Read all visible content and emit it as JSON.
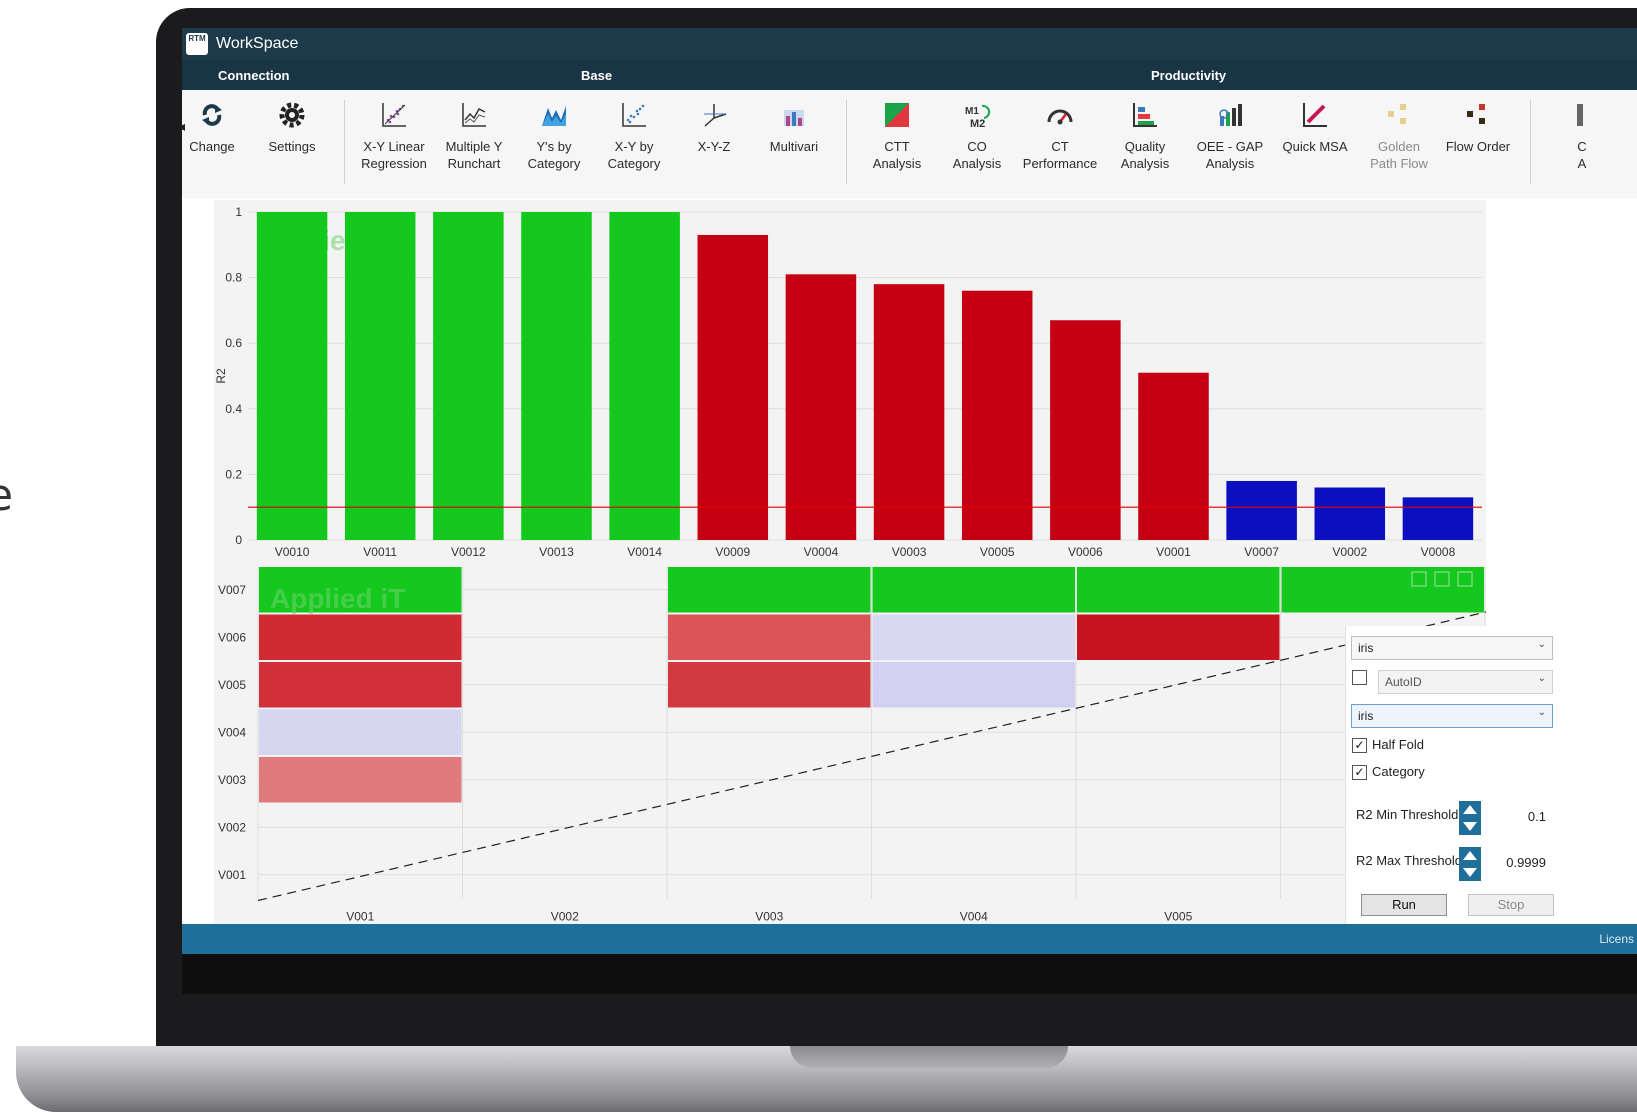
{
  "app": {
    "title": "WorkSpace",
    "logo_text": "RTM"
  },
  "ribbon_groups": [
    "Connection",
    "Base",
    "Productivity"
  ],
  "ribbon_buttons": [
    {
      "label": "Change",
      "icon": "refresh-icon"
    },
    {
      "label": "Settings",
      "icon": "gear-icon"
    },
    {
      "label": "X-Y Linear\nRegression",
      "icon": "scatter-trend-icon"
    },
    {
      "label": "Multiple Y\nRunchart",
      "icon": "runchart-icon"
    },
    {
      "label": "Y's by\nCategory",
      "icon": "category-chart-icon"
    },
    {
      "label": "X-Y by\nCategory",
      "icon": "scatter-category-icon"
    },
    {
      "label": "X-Y-Z",
      "icon": "xyz-axes-icon"
    },
    {
      "label": "Multivari",
      "icon": "multivari-icon"
    },
    {
      "label": "CTT\nAnalysis",
      "icon": "ctt-analysis-icon"
    },
    {
      "label": "CO\nAnalysis",
      "icon": "co-analysis-icon"
    },
    {
      "label": "CT\nPerformance",
      "icon": "gauge-icon"
    },
    {
      "label": "Quality\nAnalysis",
      "icon": "quality-analysis-icon"
    },
    {
      "label": "OEE - GAP\nAnalysis",
      "icon": "oee-gap-icon"
    },
    {
      "label": "Quick MSA",
      "icon": "quick-msa-icon"
    },
    {
      "label": "Golden\nPath Flow",
      "icon": "golden-path-icon"
    },
    {
      "label": "Flow Order",
      "icon": "flow-order-icon"
    },
    {
      "label": "C\nA",
      "icon": "truncated-icon"
    }
  ],
  "colors": {
    "green": "#14c81e",
    "red": "#c50013",
    "blue": "#0c0fbf",
    "threshold_line": "#e00000",
    "titlebar": "#1d3a4b",
    "statusbar": "#1e6f9a"
  },
  "watermark": "Applied iT",
  "chart_data": [
    {
      "type": "bar",
      "ylabel": "R2",
      "ylim": [
        0,
        1
      ],
      "yticks": [
        "0",
        "0.2",
        "0.4",
        "0.6",
        "0.8",
        "1"
      ],
      "categories": [
        "V0010",
        "V0011",
        "V0012",
        "V0013",
        "V0014",
        "V0009",
        "V0004",
        "V0003",
        "V0005",
        "V0006",
        "V0001",
        "V0007",
        "V0002",
        "V0008"
      ],
      "values": [
        1.0,
        1.0,
        1.0,
        1.0,
        1.0,
        0.93,
        0.81,
        0.78,
        0.76,
        0.67,
        0.51,
        0.18,
        0.16,
        0.13
      ],
      "bar_colors": [
        "green",
        "green",
        "green",
        "green",
        "green",
        "red",
        "red",
        "red",
        "red",
        "red",
        "red",
        "blue",
        "blue",
        "blue"
      ],
      "threshold": 0.1
    },
    {
      "type": "heatmap",
      "x_categories": [
        "V001",
        "V002",
        "V003",
        "V004",
        "V005"
      ],
      "y_categories": [
        "V001",
        "V002",
        "V003",
        "V004",
        "V005",
        "V006",
        "V007"
      ],
      "cells": [
        {
          "x": "V001",
          "y": "V007",
          "color": "#14c81e"
        },
        {
          "x": "V001",
          "y": "V006",
          "color": "#d12a33"
        },
        {
          "x": "V001",
          "y": "V005",
          "color": "#d12f3a"
        },
        {
          "x": "V001",
          "y": "V004",
          "color": "#d6d6f1"
        },
        {
          "x": "V001",
          "y": "V003",
          "color": "#e07a7c"
        },
        {
          "x": "V003",
          "y": "V007",
          "color": "#14c81e"
        },
        {
          "x": "V003",
          "y": "V006",
          "color": "#d95558"
        },
        {
          "x": "V003",
          "y": "V005",
          "color": "#d33a40"
        },
        {
          "x": "V004",
          "y": "V007",
          "color": "#14c81e"
        },
        {
          "x": "V004",
          "y": "V006",
          "color": "#d9d8f3"
        },
        {
          "x": "V004",
          "y": "V005",
          "color": "#d2d0f1"
        },
        {
          "x": "V005",
          "y": "V007",
          "color": "#14c81e"
        },
        {
          "x": "V005",
          "y": "V006",
          "color": "#c8141f"
        },
        {
          "x": "V006",
          "y": "V007",
          "color": "#14c81e"
        }
      ]
    }
  ],
  "panel": {
    "dataset_select": "iris",
    "autoid_checked": false,
    "autoid_select": "AutoID",
    "category_select": "iris",
    "half_fold_label": "Half Fold",
    "half_fold_checked": true,
    "category_label": "Category",
    "category_checked": true,
    "r2_min_label": "R2 Min Threshold",
    "r2_min_value": "0.1",
    "r2_max_label": "R2 Max Threshold",
    "r2_max_value": "0.9999",
    "run_label": "Run",
    "stop_label": "Stop"
  },
  "statusbar": {
    "text": "Licens"
  },
  "chart_tools": [
    "zoom-icon",
    "pan-icon",
    "reset-zoom-icon"
  ],
  "side_glyph": "e"
}
